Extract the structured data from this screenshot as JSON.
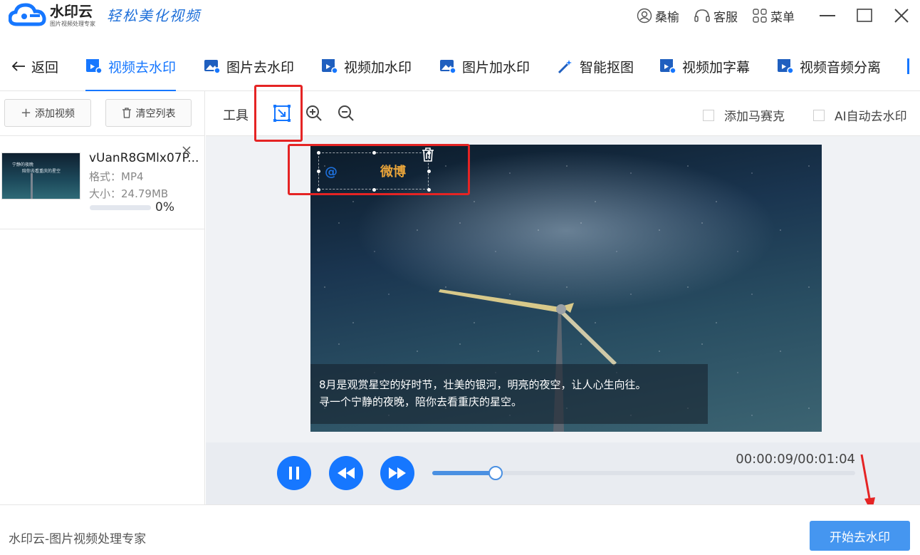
{
  "app": {
    "name": "水印云",
    "subtitle": "图片视频处理专家",
    "slogan": "轻松美化视频"
  },
  "topbar": {
    "user": "桑榆",
    "service": "客服",
    "menu": "菜单"
  },
  "nav": {
    "back": "返回",
    "tabs": [
      {
        "label": "视频去水印"
      },
      {
        "label": "图片去水印"
      },
      {
        "label": "视频加水印"
      },
      {
        "label": "图片加水印"
      },
      {
        "label": "智能抠图"
      },
      {
        "label": "视频加字幕"
      },
      {
        "label": "视频音频分离"
      }
    ]
  },
  "left_panel": {
    "add_video": "添加视频",
    "clear_list": "清空列表",
    "file": {
      "name": "vUanR8GMlx07P...",
      "format": "格式：MP4",
      "size": "大小：24.79MB",
      "progress_percent": 0,
      "progress_label": "0%",
      "thumb_caption_1": "宁静的夜晚",
      "thumb_caption_2": "陪你去看重庆的星空"
    }
  },
  "toolbar": {
    "label": "工具",
    "mosaic_label": "添加马赛克",
    "ai_label": "AI自动去水印"
  },
  "video": {
    "watermark_at": "@",
    "watermark_text": "微博",
    "subtitle_line_1": "8月是观赏星空的好时节，壮美的银河，明亮的夜空，让人心生向往。",
    "subtitle_line_2": "寻一个宁静的夜晚，陪你去看重庆的星空。"
  },
  "player": {
    "time": "00:00:09/00:01:04",
    "progress_fraction": 0.15
  },
  "footer": {
    "text": "水印云-图片视频处理专家",
    "start_button": "开始去水印"
  },
  "colors": {
    "accent": "#1677ff",
    "highlight": "#e52424",
    "start_button": "#4596f0"
  }
}
